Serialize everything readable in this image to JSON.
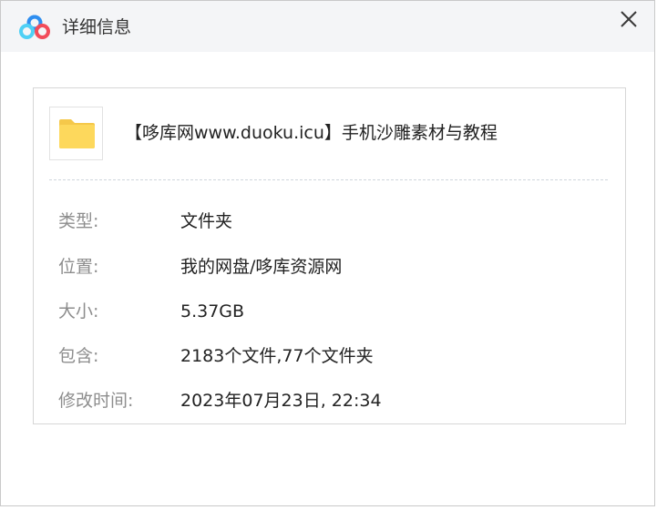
{
  "window": {
    "title": "详细信息",
    "app_icon": "baidu-netdisk-cloud-icon",
    "close_icon": "close-icon"
  },
  "file": {
    "icon": "folder-icon",
    "name": "【哆库网www.duoku.icu】手机沙雕素材与教程"
  },
  "details": [
    {
      "label": "类型:",
      "value": "文件夹"
    },
    {
      "label": "位置:",
      "value": "我的网盘/哆库资源网"
    },
    {
      "label": "大小:",
      "value": "5.37GB"
    },
    {
      "label": "包含:",
      "value": "2183个文件,77个文件夹"
    },
    {
      "label": "修改时间:",
      "value": "2023年07月23日, 22:34"
    }
  ],
  "colors": {
    "titlebar_bg": "#f4f5f7",
    "label_text": "#8d8d8d",
    "value_text": "#222222",
    "folder_yellow": "#fdd85c",
    "logo_blue": "#2e8ef0",
    "logo_cyan": "#4fd0f5",
    "logo_red": "#f24c5a"
  }
}
